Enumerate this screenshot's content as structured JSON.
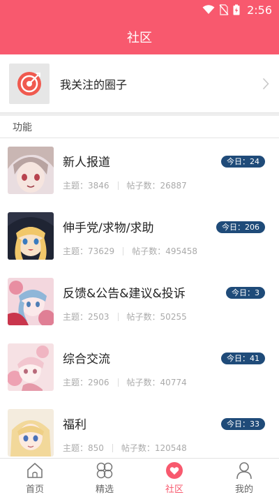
{
  "status_bar": {
    "time": "2:56"
  },
  "app_bar": {
    "title": "社区"
  },
  "my_circles": {
    "label": "我关注的圈子"
  },
  "section": {
    "label": "功能"
  },
  "forums": [
    {
      "name": "新人报道",
      "topics_label": "主题：3846",
      "posts_label": "帖子数：26887",
      "today_label": "今日：24"
    },
    {
      "name": "伸手党/求物/求助",
      "topics_label": "主题：73629",
      "posts_label": "帖子数：495458",
      "today_label": "今日：206"
    },
    {
      "name": "反馈&公告&建议&投诉",
      "topics_label": "主题：2503",
      "posts_label": "帖子数：50255",
      "today_label": "今日：3"
    },
    {
      "name": "综合交流",
      "topics_label": "主题：2906",
      "posts_label": "帖子数：40774",
      "today_label": "今日：41"
    },
    {
      "name": "福利",
      "topics_label": "主题：850",
      "posts_label": "帖子数：120548",
      "today_label": "今日：33"
    }
  ],
  "tabs": [
    {
      "label": "首页",
      "icon": "home-icon"
    },
    {
      "label": "精选",
      "icon": "clover-icon"
    },
    {
      "label": "社区",
      "icon": "heart-bubble-icon",
      "active": true
    },
    {
      "label": "我的",
      "icon": "person-icon"
    }
  ],
  "colors": {
    "accent": "#f8596e",
    "badge": "#1f4b79",
    "muted_text": "#aaaaaa"
  }
}
